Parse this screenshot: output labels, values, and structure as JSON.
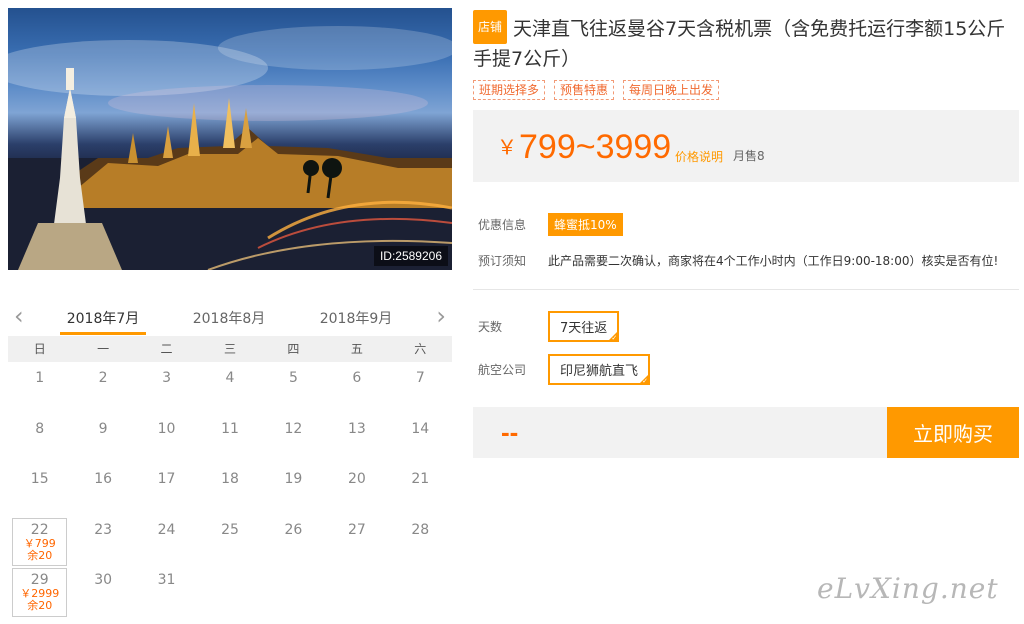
{
  "hero": {
    "image_id": "ID:2589206"
  },
  "calendar": {
    "prev_icon": "chevron-left-icon",
    "next_icon": "chevron-right-icon",
    "months": [
      {
        "label": "2018年7月",
        "active": true
      },
      {
        "label": "2018年8月",
        "active": false
      },
      {
        "label": "2018年9月",
        "active": false
      }
    ],
    "weekdays": [
      "日",
      "一",
      "二",
      "三",
      "四",
      "五",
      "六"
    ],
    "days": [
      {
        "day": "1"
      },
      {
        "day": "2"
      },
      {
        "day": "3"
      },
      {
        "day": "4"
      },
      {
        "day": "5"
      },
      {
        "day": "6"
      },
      {
        "day": "7"
      },
      {
        "day": "8"
      },
      {
        "day": "9"
      },
      {
        "day": "10"
      },
      {
        "day": "11"
      },
      {
        "day": "12"
      },
      {
        "day": "13"
      },
      {
        "day": "14"
      },
      {
        "day": "15"
      },
      {
        "day": "16"
      },
      {
        "day": "17"
      },
      {
        "day": "18"
      },
      {
        "day": "19"
      },
      {
        "day": "20"
      },
      {
        "day": "21"
      },
      {
        "day": "22",
        "price": "￥799",
        "stock": "余20"
      },
      {
        "day": "23"
      },
      {
        "day": "24"
      },
      {
        "day": "25"
      },
      {
        "day": "26"
      },
      {
        "day": "27"
      },
      {
        "day": "28"
      },
      {
        "day": "29",
        "price": "￥2999",
        "stock": "余20"
      },
      {
        "day": "30"
      },
      {
        "day": "31"
      }
    ]
  },
  "product": {
    "shop_badge": "店铺",
    "title": "天津直飞往返曼谷7天含税机票（含免费托运行李额15公斤手提7公斤）",
    "tags": [
      "班期选择多",
      "预售特惠",
      "每周日晚上出发"
    ]
  },
  "price": {
    "currency": "￥",
    "range": "799~3999",
    "explain_link": "价格说明",
    "monthly_sales": "月售8"
  },
  "info": {
    "discount_label": "优惠信息",
    "discount_value": "蜂蜜抵10%",
    "notice_label": "预订须知",
    "notice_text": "此产品需要二次确认，商家将在4个工作小时内（工作日9:00-18:00）核实是否有位!"
  },
  "options": {
    "days_label": "天数",
    "days_value": "7天往返",
    "airline_label": "航空公司",
    "airline_value": "印尼狮航直飞"
  },
  "purchase": {
    "total": "--",
    "buy_button": "立即购买"
  },
  "watermark": "eLvXing.net",
  "colors": {
    "accent": "#ff9900",
    "price": "#ff6a00"
  }
}
